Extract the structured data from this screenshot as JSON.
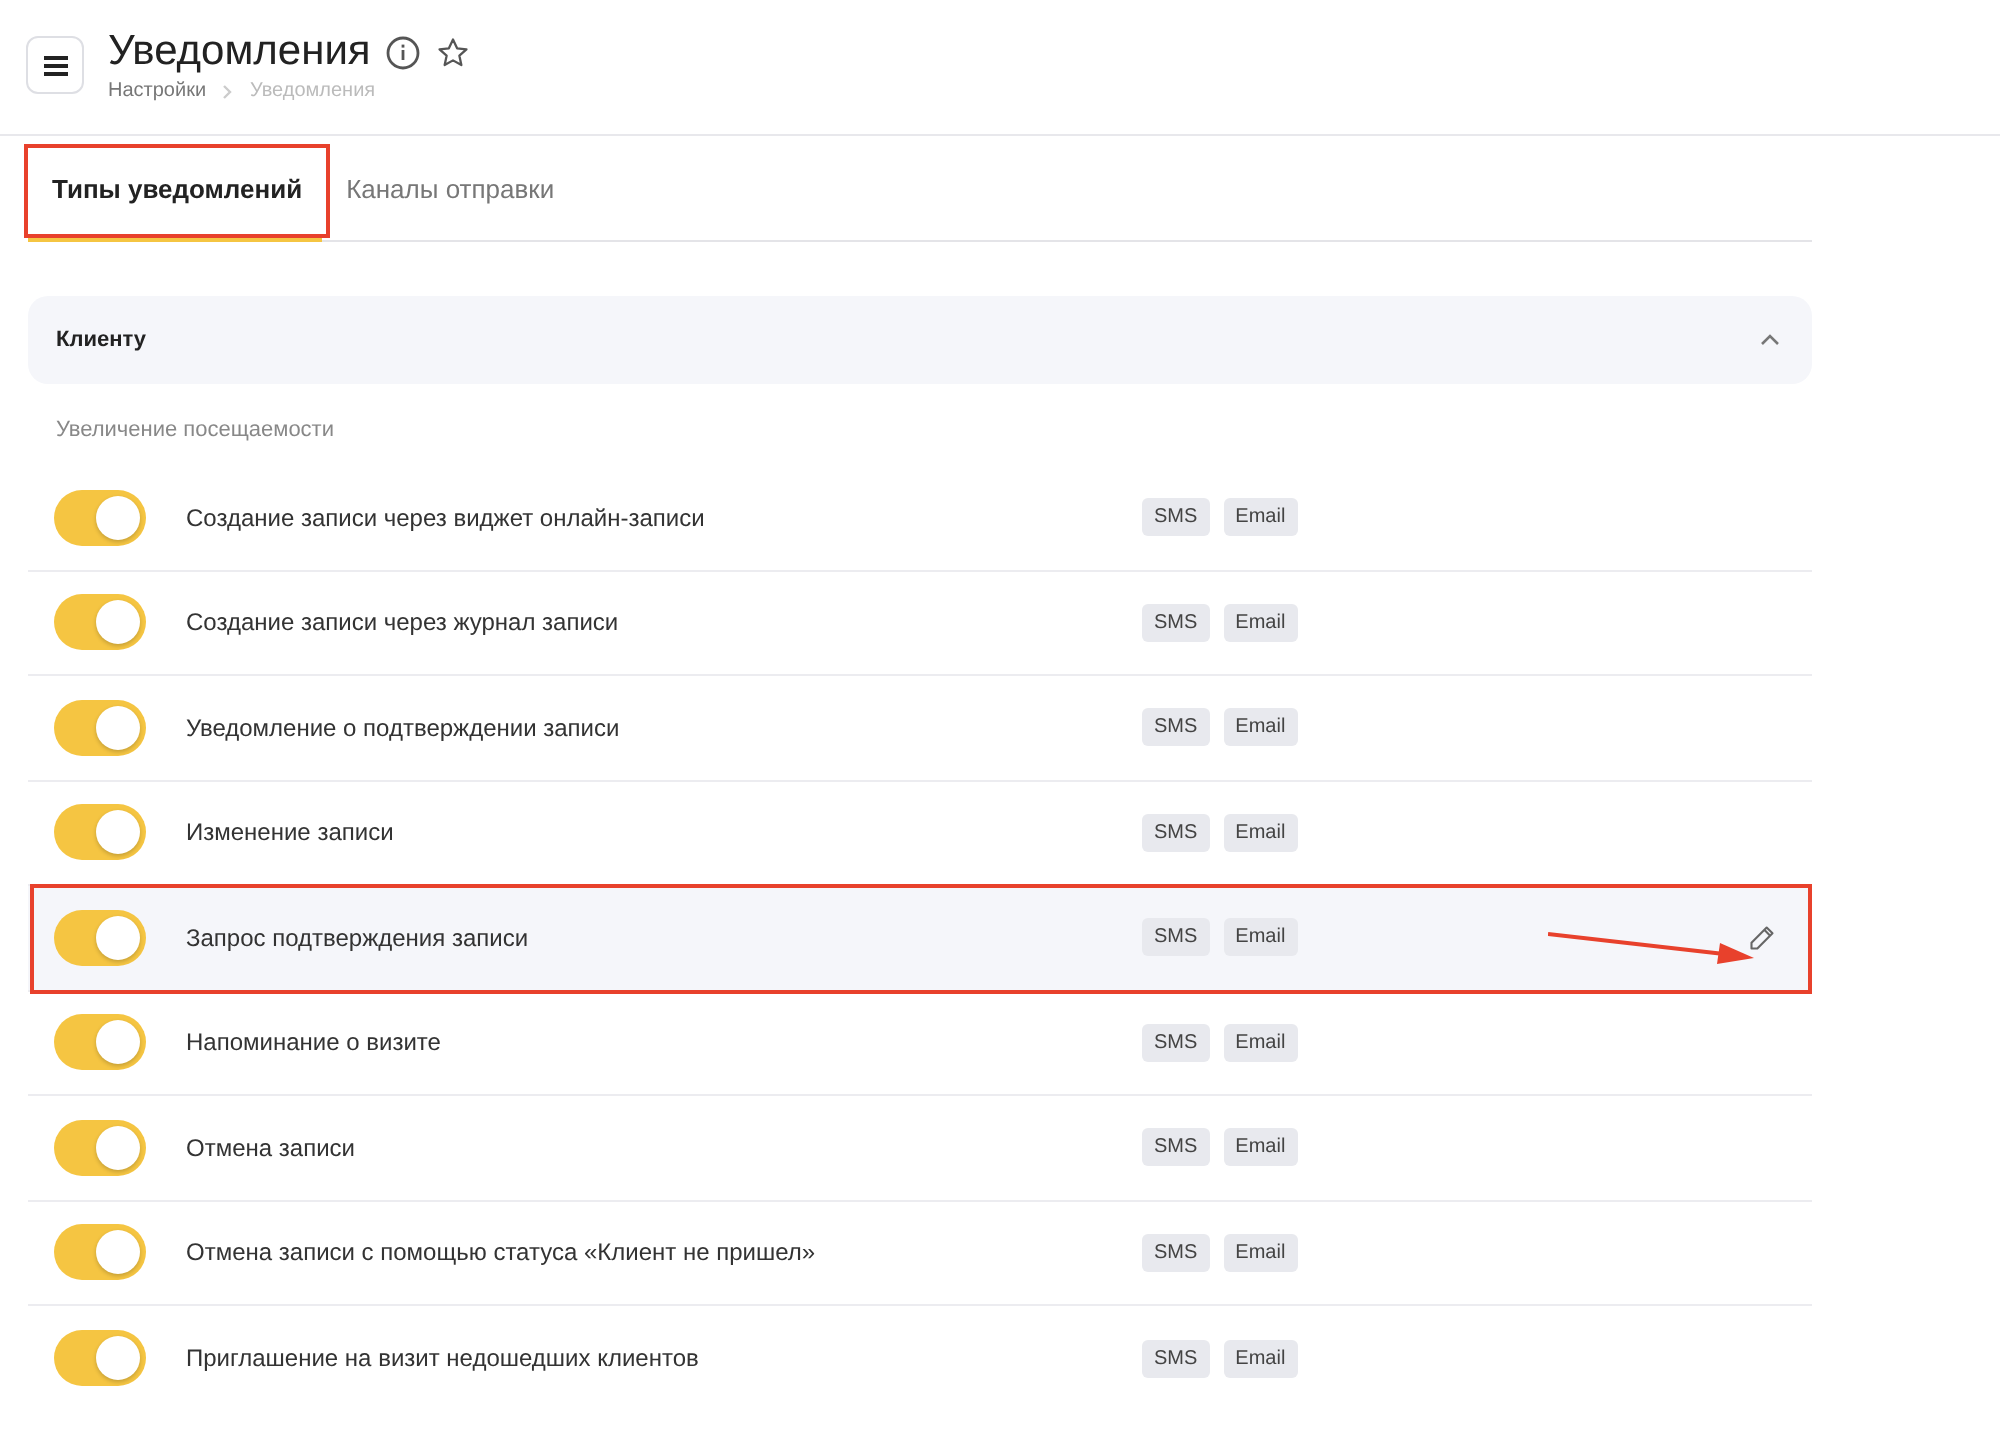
{
  "header": {
    "title": "Уведомления",
    "breadcrumbs": [
      {
        "label": "Настройки",
        "current": false
      },
      {
        "label": "Уведомления",
        "current": true
      }
    ]
  },
  "tabs": [
    {
      "label": "Типы уведомлений",
      "selected": true,
      "marked": true
    },
    {
      "label": "Каналы отправки",
      "selected": false,
      "marked": false
    }
  ],
  "section": {
    "title": "Клиенту",
    "expanded": true,
    "group": "Увеличение посещаемости",
    "rows": [
      {
        "label": "Создание записи через виджет онлайн-записи",
        "on": true,
        "hovered": false,
        "marked": false,
        "channels": [
          "SMS",
          "Email"
        ]
      },
      {
        "label": "Создание записи через журнал записи",
        "on": true,
        "hovered": false,
        "marked": false,
        "channels": [
          "SMS",
          "Email"
        ]
      },
      {
        "label": "Уведомление о подтверждении записи",
        "on": true,
        "hovered": false,
        "marked": false,
        "channels": [
          "SMS",
          "Email"
        ]
      },
      {
        "label": "Изменение записи",
        "on": true,
        "hovered": false,
        "marked": false,
        "channels": [
          "SMS",
          "Email"
        ]
      },
      {
        "label": "Запрос подтверждения записи",
        "on": true,
        "hovered": true,
        "marked": true,
        "channels": [
          "SMS",
          "Email"
        ]
      },
      {
        "label": "Напоминание о визите",
        "on": true,
        "hovered": false,
        "marked": false,
        "channels": [
          "SMS",
          "Email"
        ]
      },
      {
        "label": "Отмена записи",
        "on": true,
        "hovered": false,
        "marked": false,
        "channels": [
          "SMS",
          "Email"
        ]
      },
      {
        "label": "Отмена записи с помощью статуса «Клиент не пришел»",
        "on": true,
        "hovered": false,
        "marked": false,
        "channels": [
          "SMS",
          "Email"
        ]
      },
      {
        "label": "Приглашение на визит недошедших клиентов",
        "on": true,
        "hovered": false,
        "marked": false,
        "channels": [
          "SMS",
          "Email"
        ]
      }
    ]
  }
}
